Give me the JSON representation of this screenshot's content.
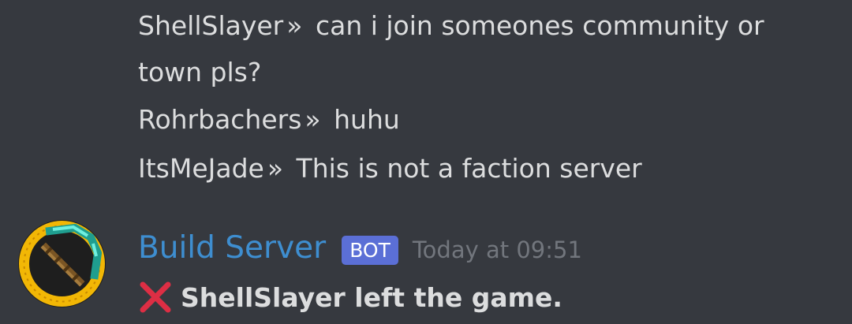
{
  "messages": [
    {
      "author": "ShellSlayer",
      "separator": "»",
      "text": "can i join someones community or"
    },
    {
      "continuation": "town pls?"
    },
    {
      "author": "Rohrbachers",
      "separator": "»",
      "text": "huhu"
    },
    {
      "author": "ItsMeJade",
      "separator": "»",
      "text": "This is not a faction server"
    }
  ],
  "bot_message": {
    "username": "Build Server",
    "tag": "BOT",
    "timestamp": "Today at 09:51",
    "event_icon": "cross-mark-icon",
    "event_text": "ShellSlayer left the game.",
    "avatar_icon": "diamond-pickaxe-icon"
  },
  "colors": {
    "background": "#36393f",
    "username": "#3e8ed0",
    "bot_tag": "#5b6fd6",
    "text": "#dcddde",
    "timestamp": "#72767d",
    "cross": "#dd2e44",
    "avatar_ring": "#f2b705"
  }
}
